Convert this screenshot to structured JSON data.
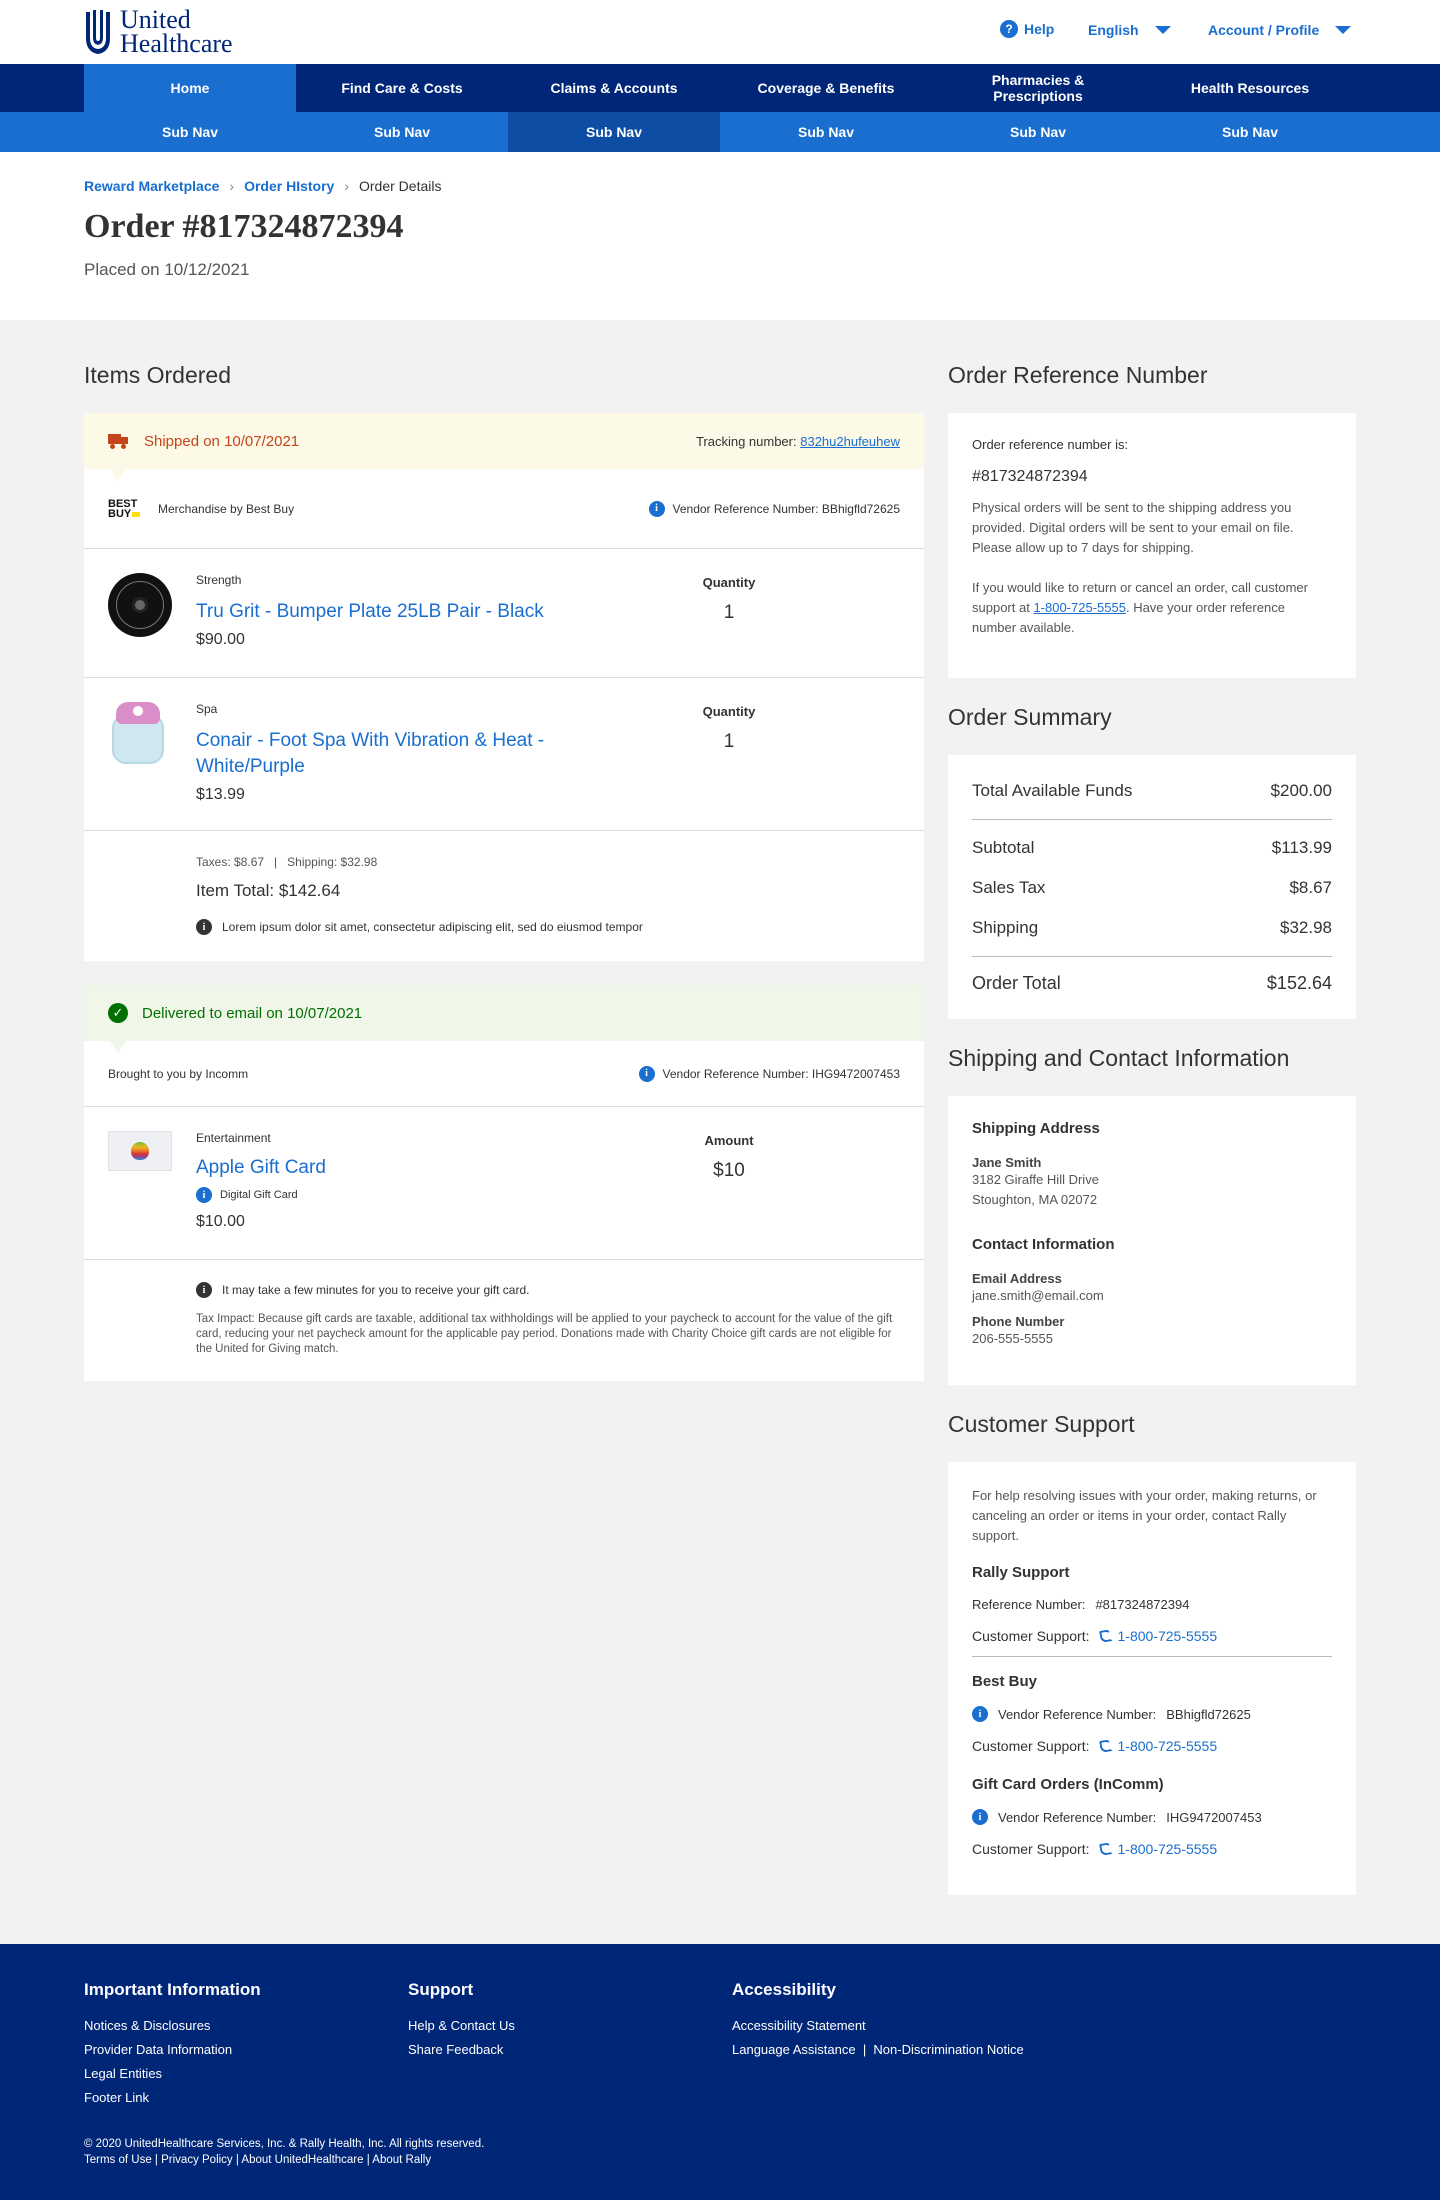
{
  "header": {
    "logo_line1": "United",
    "logo_line2": "Healthcare",
    "help": "Help",
    "language": "English",
    "account": "Account / Profile"
  },
  "main_nav": [
    "Home",
    "Find Care & Costs",
    "Claims & Accounts",
    "Coverage & Benefits",
    "Pharmacies & Prescriptions",
    "Health Resources"
  ],
  "sub_nav": [
    "Sub Nav",
    "Sub Nav",
    "Sub Nav",
    "Sub Nav",
    "Sub Nav",
    "Sub Nav"
  ],
  "breadcrumb": {
    "b1": "Reward Marketplace",
    "b2": "Order HIstory",
    "current": "Order Details"
  },
  "order": {
    "title": "Order #817324872394",
    "placed": "Placed on 10/12/2021"
  },
  "items_ordered": {
    "heading": "Items Ordered",
    "shipment": {
      "status": "Shipped on 10/07/2021",
      "tracking_label": "Tracking number:",
      "tracking_number": "832hu2hufeuhew",
      "vendor_logo_line1": "BEST",
      "vendor_logo_line2": "BUY",
      "vendor": "Merchandise by Best Buy",
      "vendor_ref": "Vendor Reference Number:  BBhigfld72625",
      "items": [
        {
          "category": "Strength",
          "name": "Tru Grit - Bumper Plate 25LB Pair - Black",
          "price": "$90.00",
          "qty_label": "Quantity",
          "qty": "1"
        },
        {
          "category": "Spa",
          "name": "Conair - Foot Spa With Vibration & Heat - White/Purple",
          "price": "$13.99",
          "qty_label": "Quantity",
          "qty": "1"
        }
      ],
      "taxes_shipping": "Taxes: $8.67   |   Shipping: $32.98",
      "item_total": "Item Total: $142.64",
      "note": "Lorem ipsum dolor sit amet, consectetur adipiscing elit, sed do eiusmod tempor"
    },
    "digital": {
      "status": "Delivered to email on 10/07/2021",
      "vendor": "Brought to you by Incomm",
      "vendor_ref": "Vendor Reference Number:  IHG9472007453",
      "item": {
        "category": "Entertainment",
        "name": "Apple Gift Card",
        "badge": "Digital Gift Card",
        "price": "$10.00",
        "amount_label": "Amount",
        "amount": "$10"
      },
      "note": "It may take a few minutes for you to receive your gift card.",
      "tax_impact": "Tax Impact: Because gift cards are taxable, additional tax withholdings will be applied to your paycheck to account for the value of the gift card, reducing your net paycheck amount for the applicable pay period. Donations made with Charity Choice gift cards are not eligible for the United for Giving match."
    }
  },
  "reference": {
    "heading": "Order Reference Number",
    "label": "Order reference number is:",
    "number": "#817324872394",
    "p1": "Physical orders will be sent to the shipping address you provided. Digital orders will be sent to your email on file. Please allow up to 7 days for shipping.",
    "p2_before": "If you would like to return or cancel an order, call customer support at ",
    "p2_phone": "1-800-725-5555",
    "p2_after": ". Have your order reference number available."
  },
  "summary": {
    "heading": "Order Summary",
    "funds_label": "Total Available Funds",
    "funds": "$200.00",
    "subtotal_label": "Subtotal",
    "subtotal": "$113.99",
    "tax_label": "Sales Tax",
    "tax": "$8.67",
    "shipping_label": "Shipping",
    "shipping": "$32.98",
    "total_label": "Order Total",
    "total": "$152.64"
  },
  "shipping_info": {
    "heading": "Shipping and Contact Information",
    "address_title": "Shipping Address",
    "name": "Jane Smith",
    "street": "3182 Giraffe Hill Drive",
    "city": "Stoughton, MA 02072",
    "contact_title": "Contact Information",
    "email_label": "Email Address",
    "email": "jane.smith@email.com",
    "phone_label": "Phone Number",
    "phone": "206-555-5555"
  },
  "support": {
    "heading": "Customer Support",
    "intro": "For help resolving issues with your order, making returns, or canceling an order or items in your order, contact Rally support.",
    "rally_title": "Rally Support",
    "rally_ref_label": "Reference Number:",
    "rally_ref": "#817324872394",
    "cs_label": "Customer Support:",
    "phone": "1-800-725-5555",
    "bestbuy_title": "Best Buy",
    "vref_label": "Vendor Reference Number:",
    "bestbuy_ref": "BBhigfld72625",
    "incomm_title": "Gift Card Orders (InComm)",
    "incomm_ref": "IHG9472007453"
  },
  "footer": {
    "col1_title": "Important Information",
    "col1_links": [
      "Notices & Disclosures",
      "Provider Data Information",
      "Legal Entities",
      "Footer Link"
    ],
    "col2_title": "Support",
    "col2_links": [
      "Help & Contact Us",
      "Share Feedback"
    ],
    "col3_title": "Accessibility",
    "col3_links": [
      "Accessibility Statement",
      "Language Assistance  |  Non-Discrimination Notice"
    ],
    "copyright": "© 2020 UnitedHealthcare Services, Inc. & Rally Health, Inc. All rights reserved.",
    "legal_links": "Terms of Use | Privacy Policy | About UnitedHealthcare | About Rally"
  }
}
